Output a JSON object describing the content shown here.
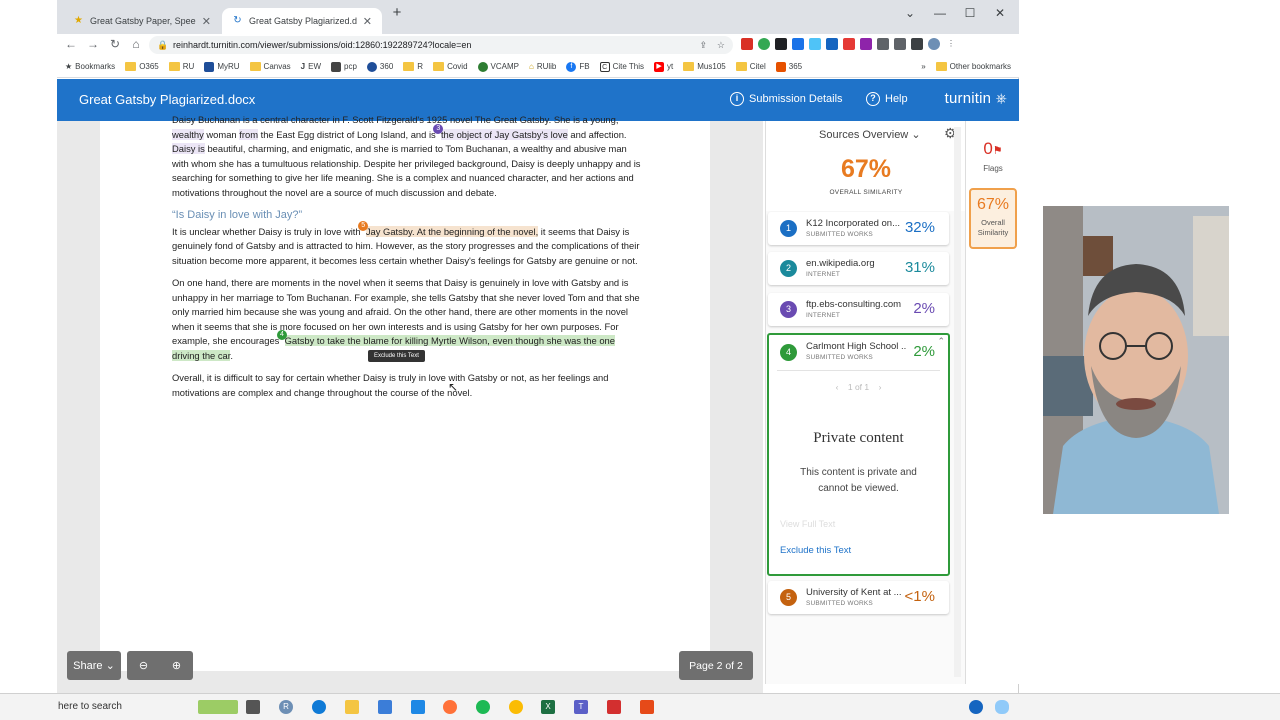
{
  "browser": {
    "tabs": [
      {
        "title": "Great Gatsby Paper, SpeedGrade",
        "active": false
      },
      {
        "title": "Great Gatsby Plagiarized.docx - T",
        "active": true
      }
    ],
    "new_tab": "+",
    "url": "reinhardt.turnitin.com/viewer/submissions/oid:12860:192289724?locale=en",
    "bookmarks": [
      "Bookmarks",
      "O365",
      "RU",
      "MyRU",
      "Canvas",
      "EW",
      "pcp",
      "360",
      "R",
      "Covid",
      "VCAMP",
      "RUlib",
      "FB",
      "Cite This",
      "yt",
      "Mus105",
      "Citel",
      "365"
    ],
    "bookmarks_overflow": "»",
    "other_bookmarks": "Other bookmarks"
  },
  "header": {
    "doc_title": "Great Gatsby Plagiarized.docx",
    "submission_details": "Submission Details",
    "help": "Help",
    "logo": "turnitin"
  },
  "document": {
    "p1_a": "Daisy Buchanan is a central character in F. Scott Fitzgerald's 1925 novel The Great Gatsby. She is a young,",
    "p1_b": "wealthy",
    "p1_c": "woman",
    "p1_d": "from",
    "p1_e": "the East Egg district of Long Island, and is",
    "p1_f": "the object of Jay Gatsby's love",
    "p1_g": "and affection.",
    "p1_h": "Daisy is",
    "p1_i": "beautiful, charming, and enigmatic, and she is married to Tom Buchanan, a wealthy and abusive man with whom she has a tumultuous relationship. Despite her privileged background, Daisy is deeply unhappy and is searching for something to give her life meaning. She is a complex and nuanced character, and her actions and motivations throughout the novel are a source of much discussion and debate.",
    "heading": "“Is Daisy in love with Jay?”",
    "p2_a": "It is unclear whether Daisy is truly in love with",
    "p2_b": "Jay Gatsby. At the beginning of the novel,",
    "p2_c": "it seems that Daisy is genuinely fond of Gatsby and is attracted to him. However, as the story progresses and the complications of their situation become more apparent, it becomes less certain whether Daisy's feelings for Gatsby are genuine or not.",
    "p3_a": "On one hand, there are moments in the novel when it seems that Daisy is genuinely in love with Gatsby and is unhappy in her marriage to Tom Buchanan. For example, she tells Gatsby that she never loved Tom and that she only married him because she was young and afraid. On the other hand, there are other moments in the novel when it seems that she is more focused on her own interests and is using Gatsby for her own purposes. For example, she encourages",
    "p3_b": "Gatsby to take the blame for killing Myrtle Wilson, even though she was the one driving the car",
    "p3_c": ".",
    "p4": "Overall, it is difficult to say for certain whether Daisy is truly in love with Gatsby or not, as her feelings and motivations are complex and change throughout the course of the novel.",
    "marker_3": "3",
    "marker_5": "5",
    "marker_4": "4",
    "tooltip": "Exclude this Text",
    "share": "Share",
    "page_indicator": "Page 2 of 2"
  },
  "sources": {
    "title": "Sources Overview",
    "overall_pct": "67%",
    "overall_label": "OVERALL SIMILARITY",
    "items": [
      {
        "num": "1",
        "name": "K12 Incorporated on...",
        "type": "SUBMITTED WORKS",
        "pct": "32%",
        "color": "#1b6fc4"
      },
      {
        "num": "2",
        "name": "en.wikipedia.org",
        "type": "INTERNET",
        "pct": "31%",
        "color": "#1b8a9c"
      },
      {
        "num": "3",
        "name": "ftp.ebs-consulting.com",
        "type": "INTERNET",
        "pct": "2%",
        "color": "#6a4bb2"
      },
      {
        "num": "4",
        "name": "Carlmont High School ...",
        "type": "SUBMITTED WORKS",
        "pct": "2%",
        "color": "#2f9a3a"
      },
      {
        "num": "5",
        "name": "University of Kent at ...",
        "type": "SUBMITTED WORKS",
        "pct": "<1%",
        "color": "#c4620f"
      }
    ],
    "pager": "1 of 1",
    "private_title": "Private content",
    "private_text": "This content is private and cannot be viewed.",
    "view_full_text": "View Full Text",
    "exclude_text": "Exclude this Text"
  },
  "flags": {
    "count": "0",
    "label": "Flags",
    "similarity_pct": "67%",
    "similarity_label": "Overall Similarity"
  },
  "taskbar": {
    "search": "here to search"
  },
  "colors": {
    "header": "#1f73c9",
    "accent_orange": "#e87b21",
    "source4_green": "#2f9a3a"
  }
}
